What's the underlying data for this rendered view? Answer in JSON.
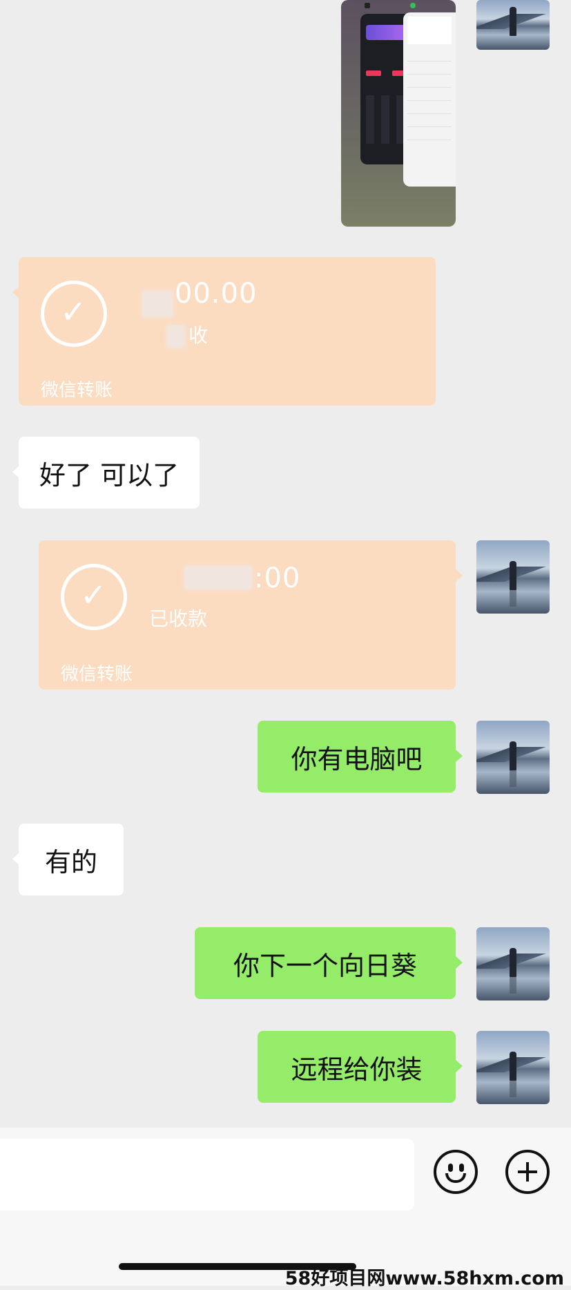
{
  "messages": {
    "transfer1": {
      "amount": "00.00",
      "status": "收",
      "label": "微信转账"
    },
    "text1": "好了 可以了",
    "transfer2": {
      "amount": ":00",
      "status": "已收款",
      "label": "微信转账"
    },
    "text2": "你有电脑吧",
    "text3": "有的",
    "text4": "你下一个向日葵",
    "text5": "远程给你装"
  },
  "toolbar": {
    "emoji_icon": "smiley-icon",
    "plus_icon": "plus-icon"
  },
  "watermark": "58好项目网www.58hxm.com",
  "colors": {
    "background": "#ededed",
    "outgoing_bubble": "#95ec69",
    "incoming_bubble": "#ffffff",
    "transfer_card": "#fcdcc0"
  }
}
